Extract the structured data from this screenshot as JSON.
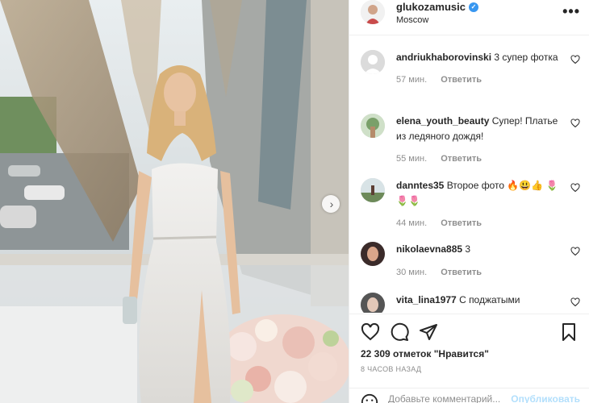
{
  "header": {
    "username": "glukozamusic",
    "location": "Moscow",
    "more_label": "•••"
  },
  "comments": [
    {
      "username": "andriukhaborovinski",
      "text": "3 супер фотка",
      "time": "57 мин.",
      "reply": "Ответить"
    },
    {
      "username": "elena_youth_beauty",
      "text": "Супер! Платье из ледяного дождя!",
      "time": "55 мин.",
      "reply": "Ответить"
    },
    {
      "username": "danntes35",
      "text": "Второе фото 🔥😃👍 🌷🌷🌷",
      "time": "44 мин.",
      "reply": "Ответить"
    },
    {
      "username": "nikolaevna885",
      "text": "3",
      "time": "30 мин.",
      "reply": "Ответить"
    },
    {
      "username": "vita_lina1977",
      "text": "С поджатыми",
      "time": "",
      "reply": ""
    }
  ],
  "post": {
    "likes": "22 309 отметок \"Нравится\"",
    "time": "8 ЧАСОВ НАЗАД"
  },
  "add_comment": {
    "placeholder": "Добавьте комментарий...",
    "publish": "Опубликовать"
  },
  "icons": {
    "like": "heart-icon",
    "comment": "comment-icon",
    "share": "share-icon",
    "save": "bookmark-icon",
    "emoji": "smile-icon",
    "next": "chevron-right-icon",
    "verified": "verified-badge-icon"
  },
  "colors": {
    "link_blue": "#3897f0",
    "publish_disabled": "#b2dffc",
    "muted": "#8e8e8e"
  }
}
